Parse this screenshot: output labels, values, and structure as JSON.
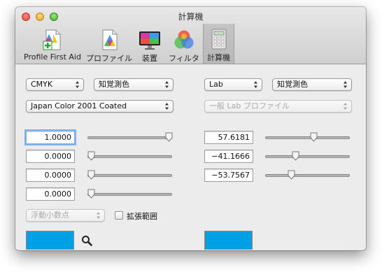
{
  "window": {
    "title": "計算機"
  },
  "toolbar": {
    "items": [
      {
        "label": "Profile First Aid",
        "icon": "profile-first-aid-icon"
      },
      {
        "label": "プロファイル",
        "icon": "profile-icon"
      },
      {
        "label": "装置",
        "icon": "display-device-icon"
      },
      {
        "label": "フィルタ",
        "icon": "color-filter-icon"
      },
      {
        "label": "計算機",
        "icon": "calculator-icon",
        "selected": true
      }
    ]
  },
  "left": {
    "colorspace": "CMYK",
    "intent": "知覚測色",
    "profile": "Japan Color 2001 Coated",
    "channels": [
      {
        "value": "1.0000",
        "level": 1.0
      },
      {
        "value": "0.0000",
        "level": 0.0
      },
      {
        "value": "0.0000",
        "level": 0.0
      },
      {
        "value": "0.0000",
        "level": 0.0
      }
    ],
    "number_format": "浮動小数点",
    "extended_range_label": "拡張範囲",
    "swatch_color": "#00a0e6"
  },
  "right": {
    "colorspace": "Lab",
    "intent": "知覚測色",
    "profile": "一般 Lab プロファイル",
    "channels": [
      {
        "value": "57.6181",
        "level": 0.576
      },
      {
        "value": "−41.1666",
        "level": 0.34
      },
      {
        "value": "−53.7567",
        "level": 0.29
      }
    ],
    "swatch_color": "#00a0e6"
  }
}
